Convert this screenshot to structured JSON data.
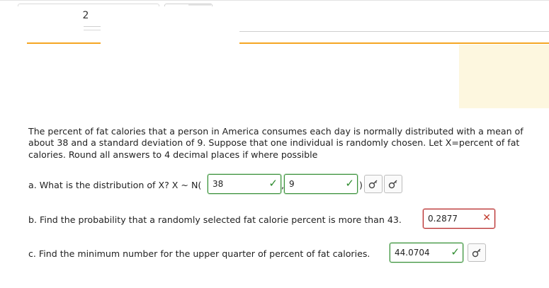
{
  "header": {
    "page_number": "2"
  },
  "question": {
    "text": "The percent of fat calories that a person in America consumes each day is normally distributed with a mean of about 38 and a standard deviation of 9. Suppose that one individual is randomly chosen. Let X=percent of fat calories. Round all answers to 4 decimal places if where possible",
    "part_a": {
      "label": "a. What is the distribution of X? X ~ N(",
      "separator": ",",
      "close": ")",
      "mean_value": "38",
      "sd_value": "9",
      "status": "correct"
    },
    "part_b": {
      "label": "b. Find the probability that a randomly selected fat calorie percent is more than 43.",
      "value": "0.2877",
      "status": "incorrect"
    },
    "part_c": {
      "label": "c. Find the minimum number for the upper quarter of percent of fat calories.",
      "value": "44.0704",
      "status": "correct"
    }
  },
  "icons": {
    "correct": "check-icon",
    "incorrect": "x-icon",
    "help": "key-icon"
  },
  "colors": {
    "accent_orange": "#f5a623",
    "correct_green": "#2e8b2e",
    "incorrect_red": "#c0392b",
    "panel_yellow": "#fdf7df"
  }
}
